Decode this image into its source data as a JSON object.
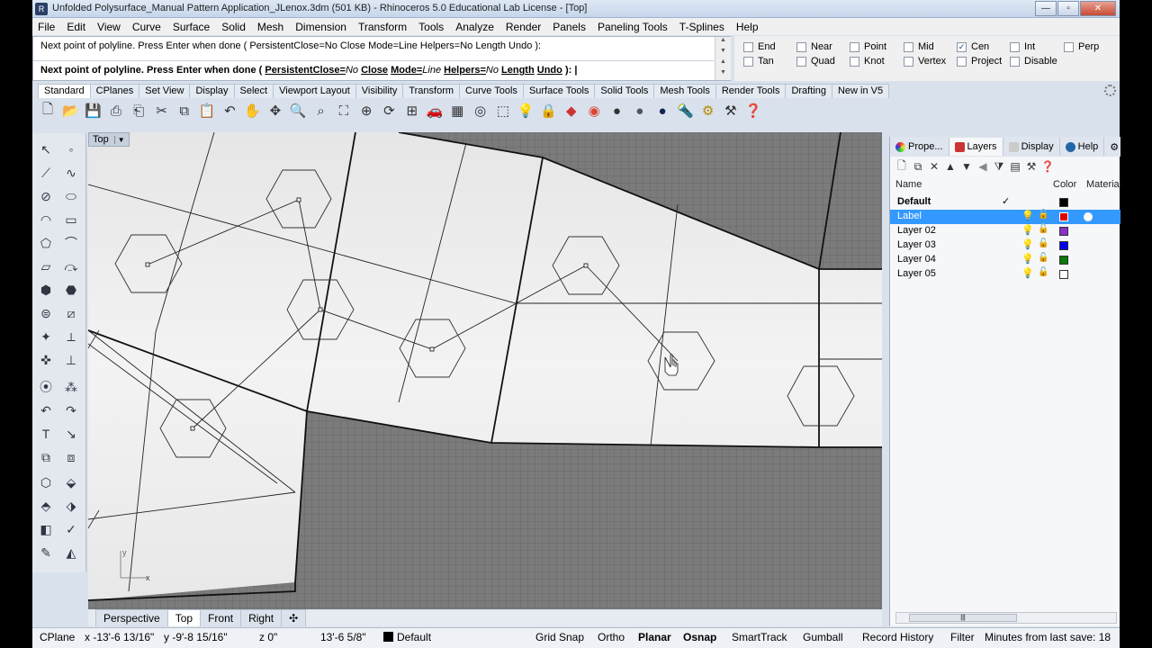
{
  "title": "Unfolded Polysurface_Manual Pattern Application_JLenox.3dm (501 KB) - Rhinoceros 5.0 Educational Lab License - [Top]",
  "window_buttons": {
    "minimize": "—",
    "maximize": "▫",
    "close": "✕"
  },
  "menu": [
    "File",
    "Edit",
    "View",
    "Curve",
    "Surface",
    "Solid",
    "Mesh",
    "Dimension",
    "Transform",
    "Tools",
    "Analyze",
    "Render",
    "Panels",
    "Paneling Tools",
    "T-Splines",
    "Help"
  ],
  "command": {
    "history": "Next point of polyline. Press Enter when done ( PersistentClose=No  Close  Mode=Line  Helpers=No  Length  Undo ):",
    "prompt_main": "Next point of polyline. Press Enter when done (",
    "opt1": "PersistentClose=",
    "opt1v": "No",
    "opt2": "Close",
    "opt3": "Mode=",
    "opt3v": "Line",
    "opt4": "Helpers=",
    "opt4v": "No",
    "opt5": "Length",
    "opt6": "Undo",
    "prompt_end": "):"
  },
  "osnap": [
    {
      "label": "End",
      "checked": false
    },
    {
      "label": "Near",
      "checked": false
    },
    {
      "label": "Point",
      "checked": false
    },
    {
      "label": "Mid",
      "checked": false
    },
    {
      "label": "Cen",
      "checked": true
    },
    {
      "label": "Int",
      "checked": false
    },
    {
      "label": "Perp",
      "checked": false
    },
    {
      "label": "Tan",
      "checked": false
    },
    {
      "label": "Quad",
      "checked": false
    },
    {
      "label": "Knot",
      "checked": false
    },
    {
      "label": "Vertex",
      "checked": false
    },
    {
      "label": "Project",
      "checked": false
    },
    {
      "label": "Disable",
      "checked": false
    }
  ],
  "toolbar_tabs": [
    "Standard",
    "CPlanes",
    "Set View",
    "Display",
    "Select",
    "Viewport Layout",
    "Visibility",
    "Transform",
    "Curve Tools",
    "Surface Tools",
    "Solid Tools",
    "Mesh Tools",
    "Render Tools",
    "Drafting",
    "New in V5"
  ],
  "toolbar_icons": [
    "new-icon",
    "open-icon",
    "save-icon",
    "print-icon",
    "import-icon",
    "cut-icon",
    "copy-icon",
    "paste-icon",
    "undo-icon",
    "pan-icon",
    "move-view-icon",
    "zoom-icon",
    "zoom-window-icon",
    "zoom-extents-icon",
    "zoom-selected-icon",
    "rotate-view-icon",
    "four-viewports-icon",
    "car-icon",
    "grid-icon",
    "cplane-icon",
    "select-icon",
    "light-icon",
    "lock-icon",
    "layer-icon",
    "color-wheel-icon",
    "shade-icon",
    "render-sphere-icon",
    "material-sphere-icon",
    "flashlight-icon",
    "options-gear-icon",
    "tools-icon",
    "help-icon"
  ],
  "viewport": {
    "label": "Top",
    "axis_x": "x",
    "axis_y": "y"
  },
  "viewport_tabs": [
    "Perspective",
    "Top",
    "Front",
    "Right"
  ],
  "panel": {
    "tabs": [
      "Prope...",
      "Layers",
      "Display",
      "Help"
    ],
    "col_name": "Name",
    "col_color": "Color",
    "col_material": "Material",
    "current_mark": "✓",
    "layers": [
      {
        "name": "Default",
        "color": "#000000"
      },
      {
        "name": "Label",
        "color": "#e00000"
      },
      {
        "name": "Layer 02",
        "color": "#8a2fc8"
      },
      {
        "name": "Layer 03",
        "color": "#0000ee"
      },
      {
        "name": "Layer 04",
        "color": "#0a7a0a"
      },
      {
        "name": "Layer 05",
        "color": "#ffffff"
      }
    ]
  },
  "status": {
    "cplane": "CPlane",
    "x": "x -13'-6 13/16\"",
    "y": "y -9'-8 15/16\"",
    "z": "z 0\"",
    "dist": "13'-6 5/8\"",
    "layer": "Default",
    "grid_snap": "Grid Snap",
    "ortho": "Ortho",
    "planar": "Planar",
    "osnap": "Osnap",
    "smarttrack": "SmartTrack",
    "gumball": "Gumball",
    "record_history": "Record History",
    "filter": "Filter",
    "save_msg": "Minutes from last save: 18"
  }
}
